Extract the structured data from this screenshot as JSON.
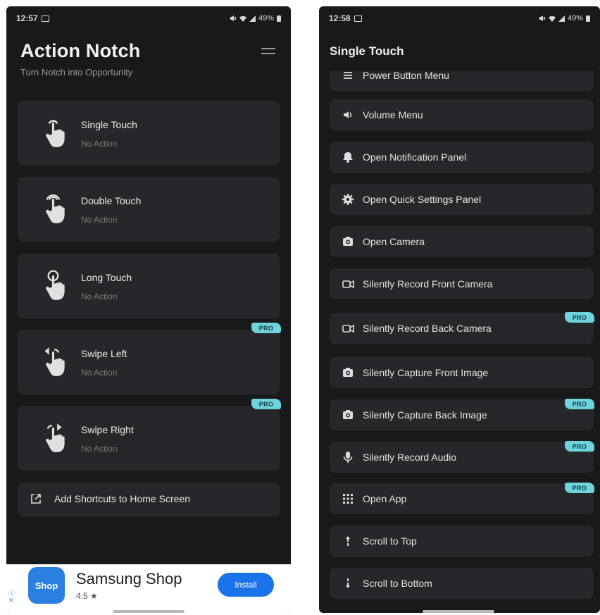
{
  "left_screen": {
    "status": {
      "time": "12:57",
      "battery": "49%"
    },
    "title": "Action Notch",
    "subtitle": "Turn Notch into Opportunity",
    "gestures": [
      {
        "label": "Single Touch",
        "sub": "No Action",
        "icon": "single-touch-icon"
      },
      {
        "label": "Double Touch",
        "sub": "No Action",
        "icon": "double-touch-icon"
      },
      {
        "label": "Long Touch",
        "sub": "No Action",
        "icon": "long-touch-icon"
      },
      {
        "label": "Swipe Left",
        "sub": "No Action",
        "icon": "swipe-left-icon",
        "badge": "PRO"
      },
      {
        "label": "Swipe Right",
        "sub": "No Action",
        "icon": "swipe-right-icon",
        "badge": "PRO"
      }
    ],
    "shortcut_label": "Add Shortcuts to Home Screen",
    "ad": {
      "logo_text": "Shop",
      "app_name": "Samsung Shop",
      "rating": "4.5 ★",
      "install_label": "Install"
    }
  },
  "right_screen": {
    "status": {
      "time": "12:58",
      "battery": "49%"
    },
    "title": "Single Touch",
    "options": [
      {
        "label": "Power Button Menu",
        "icon": "menu-icon"
      },
      {
        "label": "Volume Menu",
        "icon": "volume-icon"
      },
      {
        "label": "Open Notification Panel",
        "icon": "bell-icon"
      },
      {
        "label": "Open Quick Settings Panel",
        "icon": "gear-icon"
      },
      {
        "label": "Open Camera",
        "icon": "camera-icon"
      },
      {
        "label": "Silently Record Front Camera",
        "icon": "video-icon"
      },
      {
        "label": "Silently Record Back Camera",
        "icon": "video-icon",
        "badge": "PRO"
      },
      {
        "label": "Silently Capture Front Image",
        "icon": "camera-icon"
      },
      {
        "label": "Silently Capture Back Image",
        "icon": "camera-icon",
        "badge": "PRO"
      },
      {
        "label": "Silently Record Audio",
        "icon": "mic-icon",
        "badge": "PRO"
      },
      {
        "label": "Open App",
        "icon": "grid-icon",
        "badge": "PRO"
      },
      {
        "label": "Scroll to Top",
        "icon": "arrow-up-icon"
      },
      {
        "label": "Scroll to Bottom",
        "icon": "arrow-down-icon"
      }
    ]
  },
  "colors": {
    "background": "#18191b",
    "card": "#26272a",
    "pro_badge": "#6fd3dc",
    "install_button": "#1a73e8"
  }
}
